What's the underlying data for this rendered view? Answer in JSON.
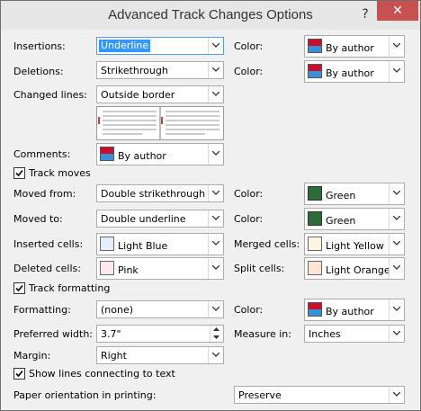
{
  "window": {
    "title": "Advanced Track Changes Options",
    "help": "?",
    "close": "✕"
  },
  "rows": {
    "insertions": {
      "label": "Insertions:",
      "value": "Underline",
      "color_label": "Color:",
      "color_value": "By author"
    },
    "deletions": {
      "label": "Deletions:",
      "value": "Strikethrough",
      "color_label": "Color:",
      "color_value": "By author"
    },
    "changed_lines": {
      "label": "Changed lines:",
      "value": "Outside border"
    },
    "comments": {
      "label": "Comments:",
      "value": "By author"
    },
    "track_moves": {
      "label": "Track moves",
      "checked": true
    },
    "moved_from": {
      "label": "Moved from:",
      "value": "Double strikethrough",
      "color_label": "Color:",
      "color_value": "Green"
    },
    "moved_to": {
      "label": "Moved to:",
      "value": "Double underline",
      "color_label": "Color:",
      "color_value": "Green"
    },
    "inserted_cells": {
      "label": "Inserted cells:",
      "value": "Light Blue"
    },
    "merged_cells": {
      "label": "Merged cells:",
      "value": "Light Yellow"
    },
    "deleted_cells": {
      "label": "Deleted cells:",
      "value": "Pink"
    },
    "split_cells": {
      "label": "Split cells:",
      "value": "Light Orange"
    },
    "track_formatting": {
      "label": "Track formatting",
      "checked": true
    },
    "formatting": {
      "label": "Formatting:",
      "value": "(none)",
      "color_label": "Color:",
      "color_value": "By author"
    },
    "preferred_width": {
      "label": "Preferred width:",
      "value": "3.7\""
    },
    "measure_in": {
      "label": "Measure in:",
      "value": "Inches"
    },
    "margin": {
      "label": "Margin:",
      "value": "Right"
    },
    "show_lines": {
      "label": "Show lines connecting to text",
      "checked": true
    },
    "paper_orientation": {
      "label": "Paper orientation in printing:",
      "value": "Preserve"
    }
  },
  "colors": {
    "green": "#2e6b3a",
    "light_blue": "#e3f0fb",
    "light_yellow": "#fff4e0",
    "pink": "#fde8ef",
    "light_orange": "#fde6d8",
    "author_top": "#c8102e",
    "author_bottom": "#3b8fd6",
    "close_red": "#c75050"
  },
  "icons": [
    "chevron-down-icon",
    "checkmark-icon",
    "spin-up-icon",
    "spin-down-icon"
  ]
}
